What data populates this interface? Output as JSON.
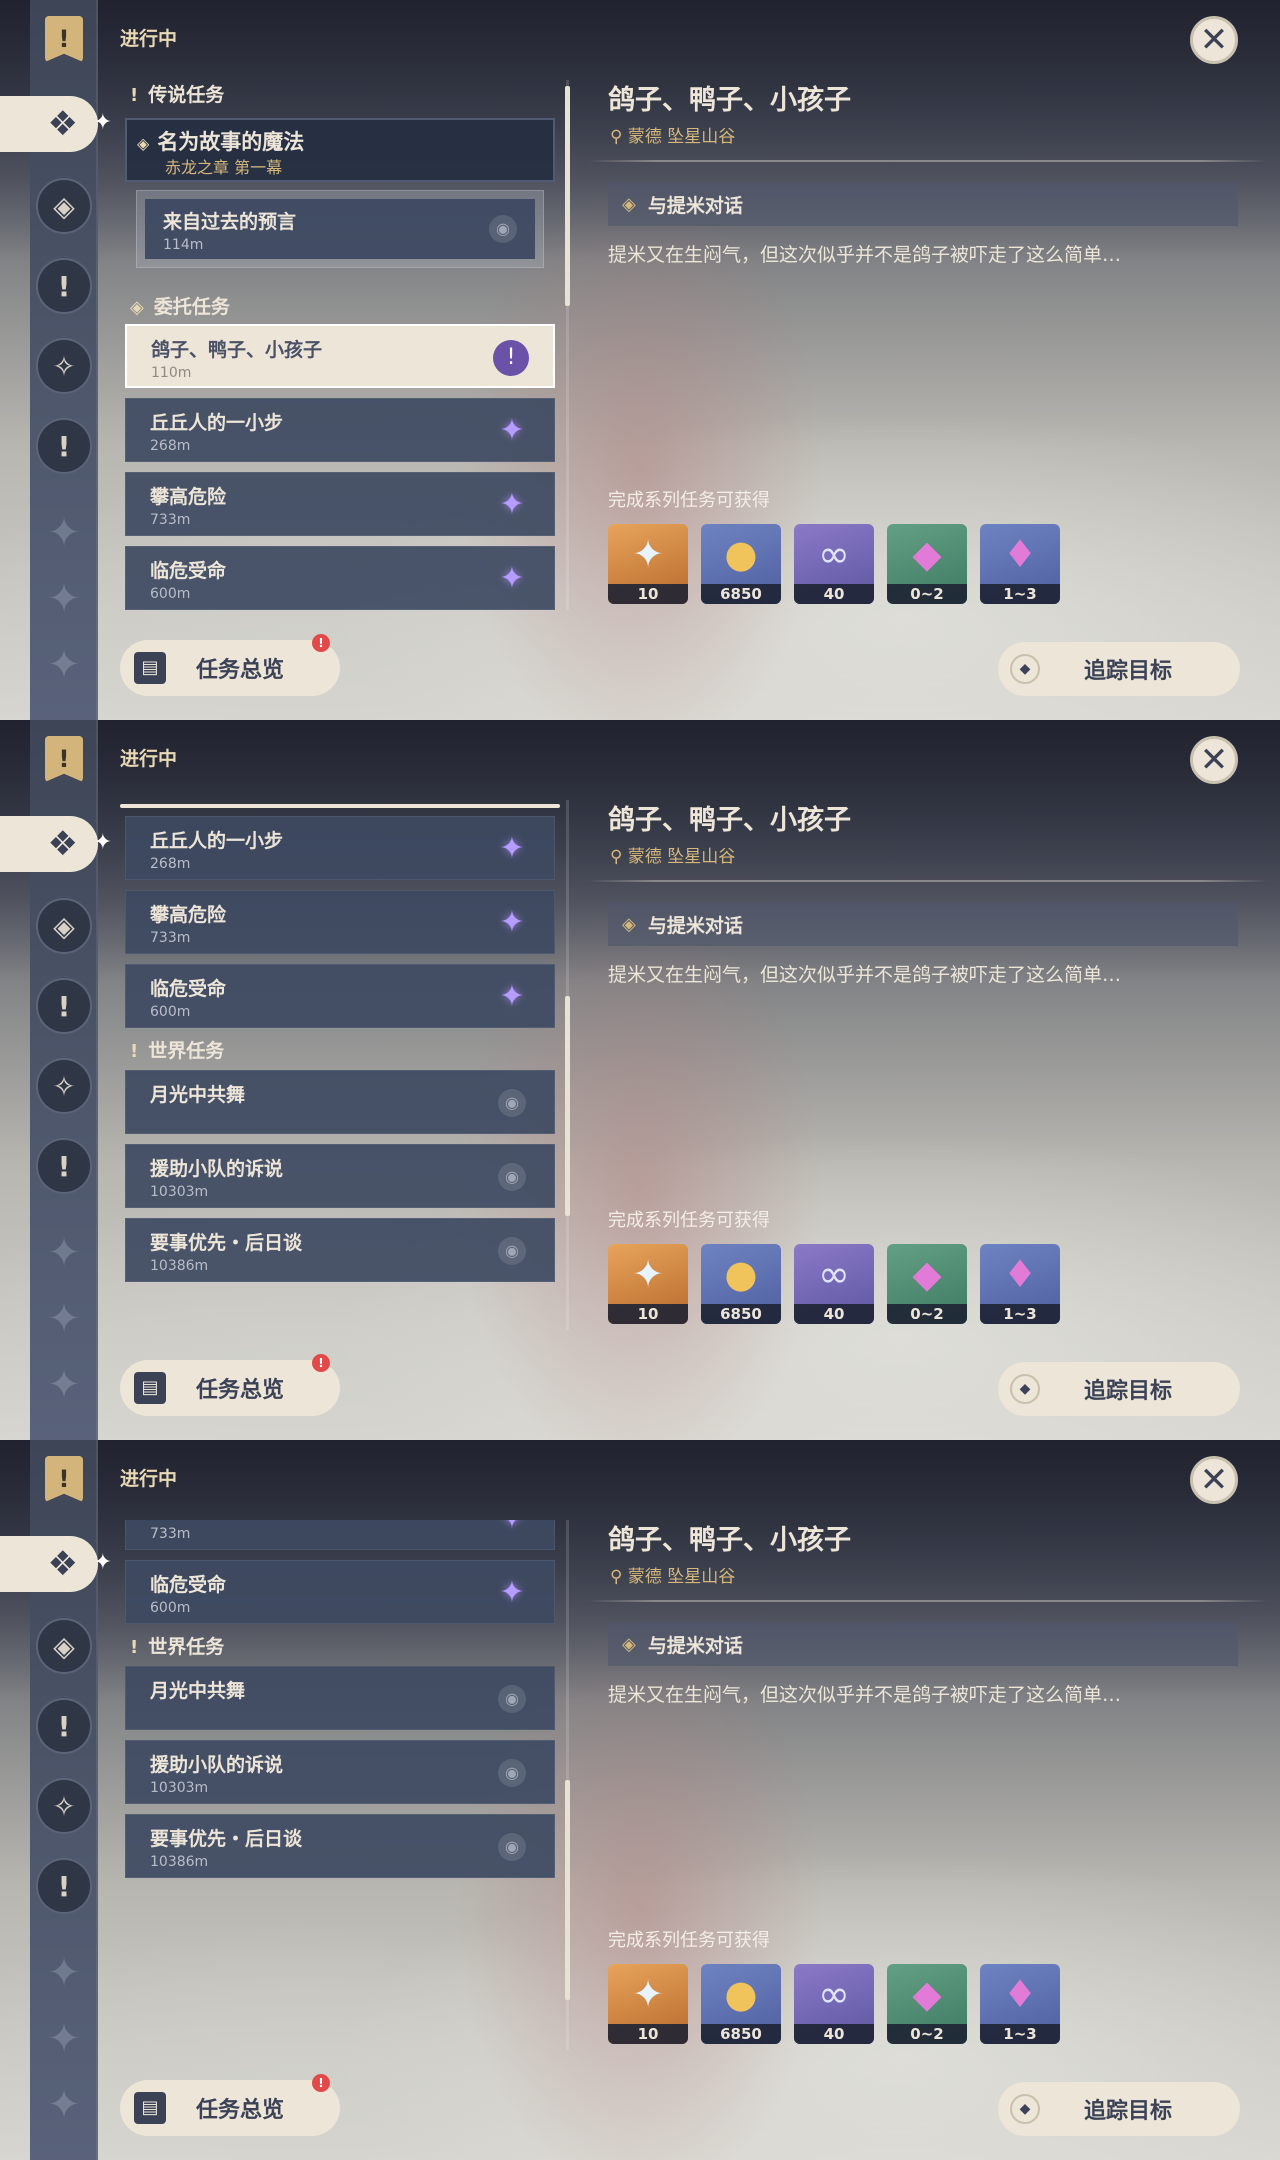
{
  "ui": {
    "in_progress": "进行中",
    "sections": {
      "legend": "传说任务",
      "commission": "委托任务",
      "world": "世界任务"
    },
    "legend_quest": {
      "title": "名为故事的魔法",
      "chapter": "赤龙之章 第一幕",
      "step_title": "来自过去的预言",
      "step_distance": "114m"
    },
    "commissions": [
      {
        "title": "鸽子、鸭子、小孩子",
        "distance": "110m"
      },
      {
        "title": "丘丘人的一小步",
        "distance": "268m"
      },
      {
        "title": "攀高危险",
        "distance": "733m"
      },
      {
        "title": "临危受命",
        "distance": "600m"
      }
    ],
    "world_quests": [
      {
        "title": "月光中共舞",
        "distance": ""
      },
      {
        "title": "援助小队的诉说",
        "distance": "10303m"
      },
      {
        "title": "要事优先・后日谈",
        "distance": "10386m"
      }
    ],
    "overview_label": "任务总览",
    "overview_badge": "!",
    "track_label": "追踪目标",
    "detail": {
      "title": "鸽子、鸭子、小孩子",
      "location": "蒙德 坠星山谷",
      "objective": "与提米对话",
      "description": "提米又在生闷气，但这次似乎并不是鸽子被吓走了这么简单…",
      "rewards_label": "完成系列任务可获得",
      "rewards": [
        {
          "icon": "primogem-icon",
          "count": "10"
        },
        {
          "icon": "mora-icon",
          "count": "6850"
        },
        {
          "icon": "adventure-exp-icon",
          "count": "40"
        },
        {
          "icon": "crystal-chunk-icon",
          "count": "0~2"
        },
        {
          "icon": "crystal-cluster-icon",
          "count": "1~3"
        }
      ]
    }
  }
}
